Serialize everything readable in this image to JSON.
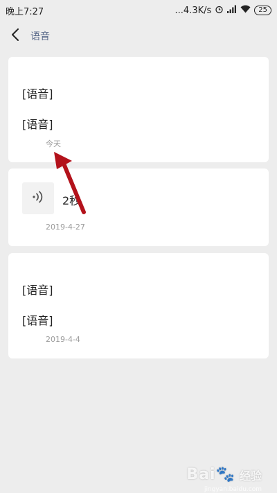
{
  "status_bar": {
    "time": "晚上7:27",
    "network_speed": "...4.3K/s",
    "battery": "25",
    "icons": [
      "alarm-icon",
      "signal-icon",
      "wifi-icon",
      "battery-icon"
    ]
  },
  "nav": {
    "back_icon": "chevron-left-icon",
    "title": "语音"
  },
  "notes": [
    {
      "lines": [
        "[语音]",
        "[语音]"
      ],
      "date": "今天"
    },
    {
      "voice_icon": "voice-icon",
      "duration": "2秒",
      "date": "2019-4-27"
    },
    {
      "lines": [
        "[语音]",
        "[语音]"
      ],
      "date": "2019-4-4"
    }
  ],
  "watermark": {
    "logo": "Bai🐾",
    "brand": "经验",
    "url": "jingyan.baidu.com"
  },
  "colors": {
    "background": "#ededed",
    "card": "#ffffff",
    "nav_title": "#5a6a8a",
    "date": "#9b9b9b",
    "annotation_arrow": "#b3121b"
  }
}
